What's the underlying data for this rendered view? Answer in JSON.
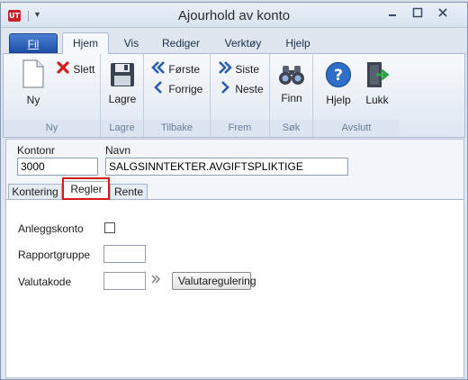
{
  "window": {
    "title": "Ajourhold av konto",
    "app_icon": "UT",
    "controls": [
      "minimize-icon",
      "maximize-icon",
      "close-icon"
    ]
  },
  "ribbon": {
    "tabs": [
      {
        "label": "Fil",
        "active": false
      },
      {
        "label": "Hjem",
        "active": true
      },
      {
        "label": "Vis",
        "active": false
      },
      {
        "label": "Rediger",
        "active": false
      },
      {
        "label": "Verktøy",
        "active": false
      },
      {
        "label": "Hjelp",
        "active": false
      }
    ],
    "groups": {
      "ny": {
        "label": "Ny",
        "new_label": "Ny",
        "delete_label": "Slett"
      },
      "lagre": {
        "label": "Lagre",
        "save_label": "Lagre"
      },
      "tilbake": {
        "label": "Tilbake",
        "first_label": "Første",
        "prev_label": "Forrige"
      },
      "frem": {
        "label": "Frem",
        "last_label": "Siste",
        "next_label": "Neste"
      },
      "sok": {
        "label": "Søk",
        "find_label": "Finn"
      },
      "avslutt": {
        "label": "Avslutt",
        "help_label": "Hjelp",
        "close_label": "Lukk"
      }
    }
  },
  "form": {
    "kontonr_label": "Kontonr",
    "kontonr_value": "3000",
    "navn_label": "Navn",
    "navn_value": "SALGSINNTEKTER.AVGIFTSPLIKTIGE",
    "tabs": [
      {
        "label": "Kontering",
        "active": false
      },
      {
        "label": "Regler",
        "active": true
      },
      {
        "label": "Rente",
        "active": false
      }
    ],
    "regler": {
      "anleggskonto_label": "Anleggskonto",
      "anleggskonto_checked": false,
      "rapportgruppe_label": "Rapportgruppe",
      "rapportgruppe_value": "",
      "valutakode_label": "Valutakode",
      "valutakode_value": "",
      "lookup_icon": "double-chevron-right-icon",
      "valutaregulering_label": "Valutaregulering"
    }
  },
  "colors": {
    "highlight": "#d61a1a",
    "file_tab": "#1f4fa8",
    "delete_red": "#d41f1f",
    "nav_blue": "#2a5db0"
  }
}
